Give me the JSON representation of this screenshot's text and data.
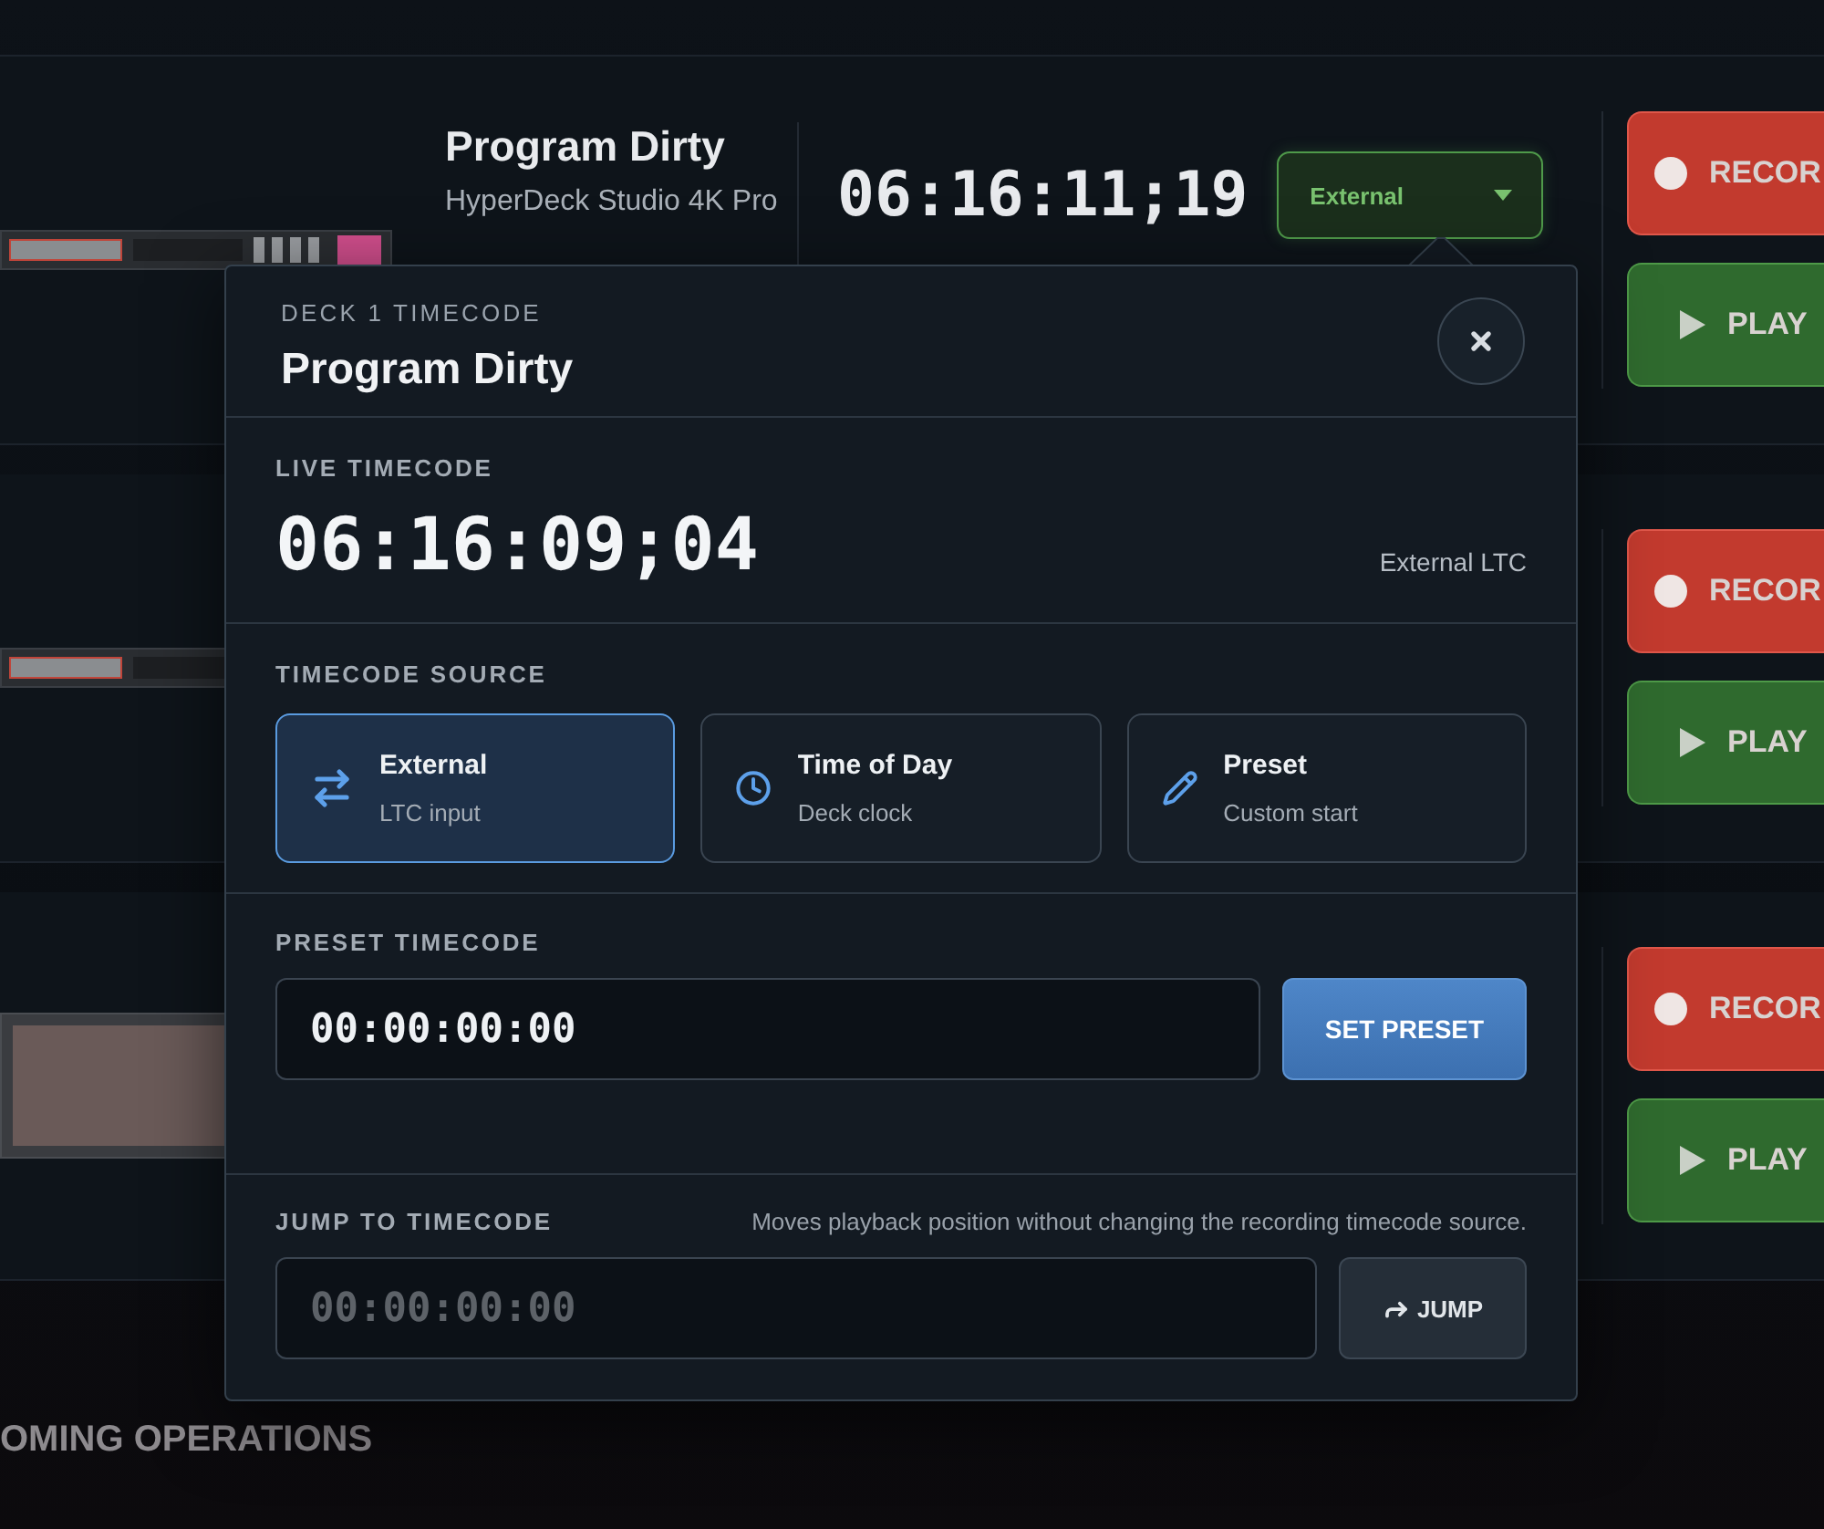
{
  "decks": [
    {
      "kind": "rack",
      "title": "Program Dirty",
      "model": "HyperDeck Studio 4K Pro",
      "timecode": "06:16:11;19",
      "source": "External",
      "record": "RECOR",
      "play": "PLAY"
    },
    {
      "kind": "rack",
      "record": "RECOR",
      "play": "PLAY"
    },
    {
      "kind": "screen",
      "record": "RECOR",
      "play": "PLAY"
    }
  ],
  "section_title": "OMING OPERATIONS",
  "popover": {
    "eyebrow": "DECK 1 TIMECODE",
    "title": "Program Dirty",
    "live": {
      "label": "LIVE TIMECODE",
      "value": "06:16:09;04",
      "source": "External LTC"
    },
    "source": {
      "label": "TIMECODE SOURCE",
      "options": [
        {
          "kind": "external",
          "title": "External",
          "subtitle": "LTC input",
          "selected": true
        },
        {
          "kind": "clock",
          "title": "Time of Day",
          "subtitle": "Deck clock",
          "selected": false
        },
        {
          "kind": "preset",
          "title": "Preset",
          "subtitle": "Custom start",
          "selected": false
        }
      ]
    },
    "preset": {
      "label": "PRESET TIMECODE",
      "value": "00:00:00:00",
      "button": "SET PRESET"
    },
    "jump": {
      "label": "JUMP TO TIMECODE",
      "hint": "Moves playback position without changing the recording timecode source.",
      "placeholder": "00:00:00:00",
      "button": "JUMP"
    }
  }
}
